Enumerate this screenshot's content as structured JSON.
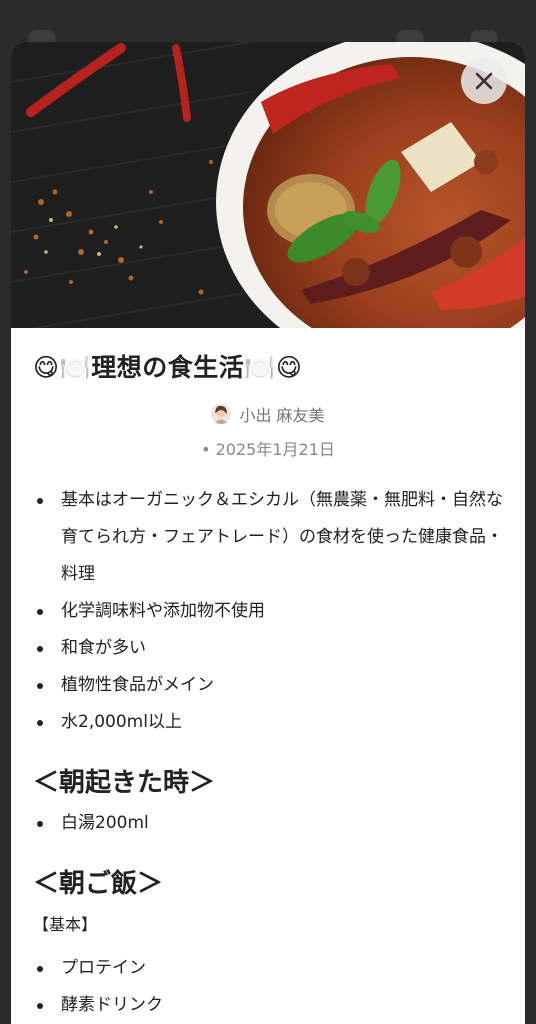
{
  "modal": {
    "close_label": "×",
    "title": "😋🍽️理想の食生活🍽️😋",
    "author": "小出 麻友美",
    "date": "• 2025年1月21日"
  },
  "sections": {
    "intro": [
      "基本はオーガニック＆エシカル（無農薬・無肥料・自然な育てられ方・フェアトレード）の食材を使った健康食品・料理",
      "化学調味料や添加物不使用",
      "和食が多い",
      "植物性食品がメイン",
      "水2,000ml以上"
    ],
    "wake_heading": "＜朝起きた時＞",
    "wake_items": [
      "白湯200ml"
    ],
    "breakfast_heading": "＜朝ご飯＞",
    "breakfast_label": "【基本】",
    "breakfast_items": [
      "プロテイン",
      "酵素ドリンク"
    ]
  },
  "colors": {
    "backdrop": "#2b2b2b",
    "text": "#222222",
    "muted": "#777777"
  }
}
